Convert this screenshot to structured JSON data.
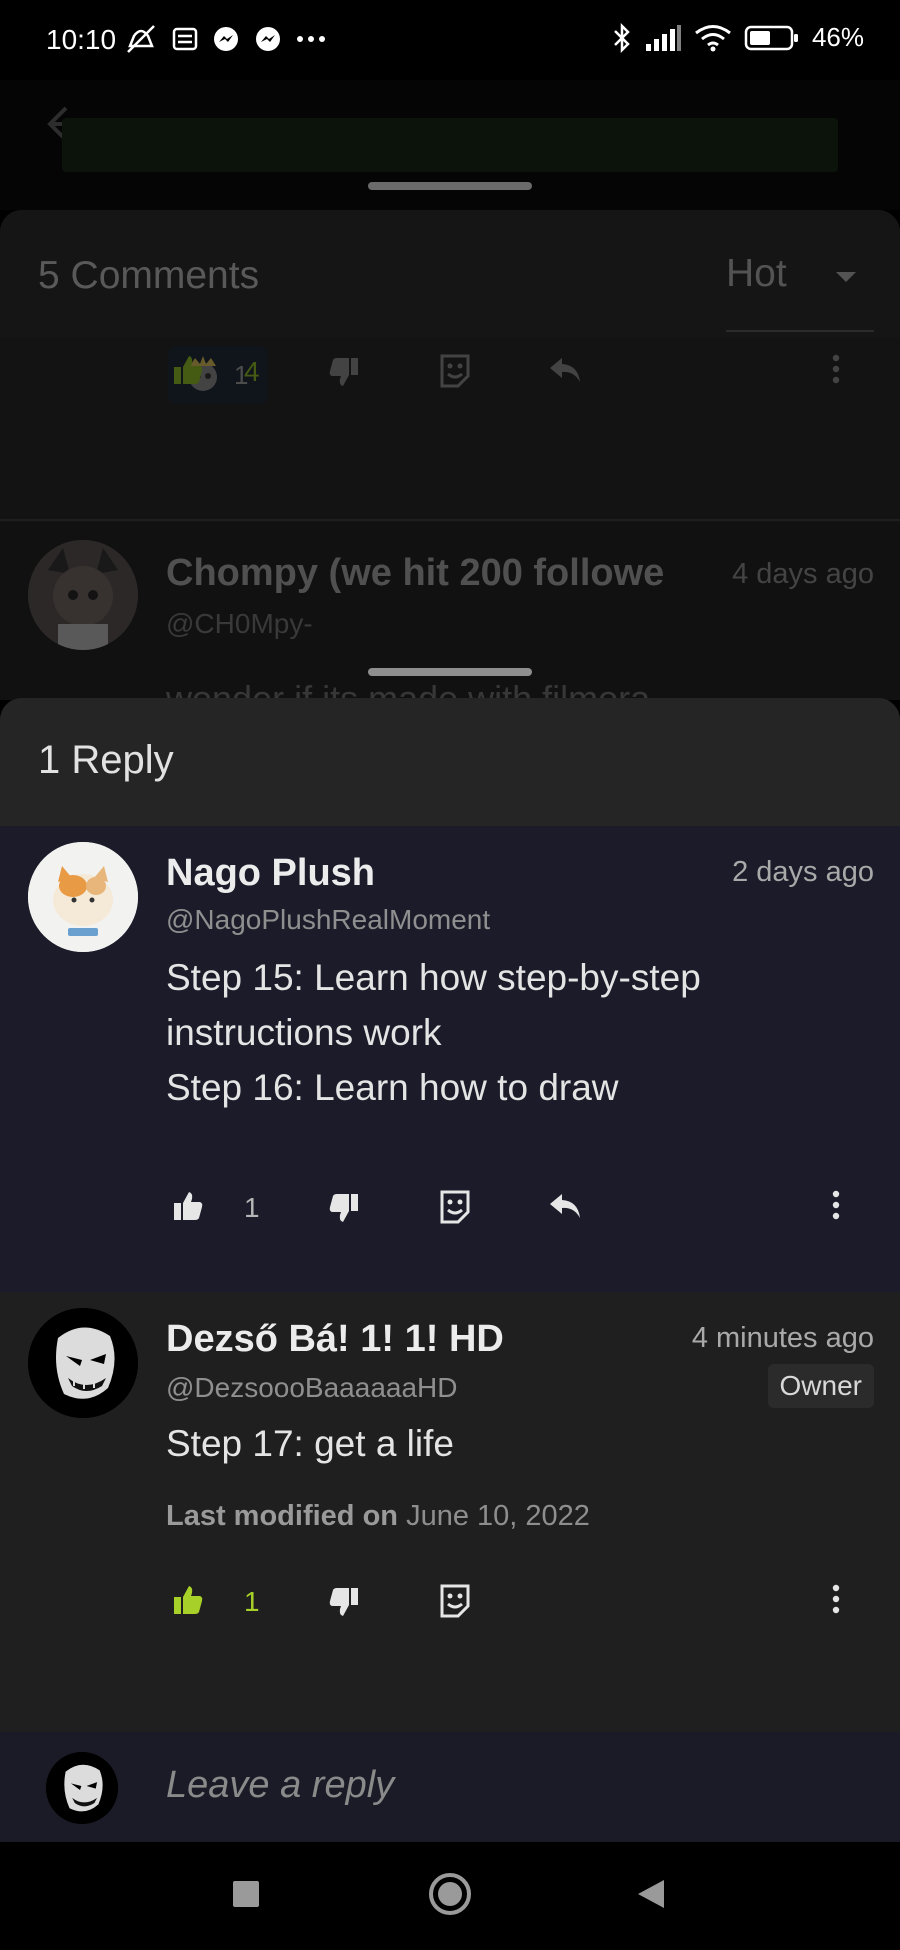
{
  "status_bar": {
    "time": "10:10",
    "battery": "46%",
    "icons": [
      "mute-icon",
      "news-icon",
      "messenger-icon",
      "messenger-icon",
      "more-dots-icon",
      "bluetooth-icon",
      "signal-icon",
      "wifi-icon",
      "battery-icon"
    ]
  },
  "comments_sheet": {
    "title": "5 Comments",
    "sort": "Hot",
    "prev_comment": {
      "reaction_count": "1",
      "like_count": "4"
    },
    "dim_comment": {
      "name": "Chompy (we hit 200 followe",
      "time": "4 days ago",
      "handle": "@CH0Mpy-",
      "body": "wonder if its made with filmora"
    }
  },
  "reply_sheet": {
    "title": "1 Reply",
    "comments": [
      {
        "name": "Nago Plush",
        "time": "2 days ago",
        "handle": "@NagoPlushRealMoment",
        "paragraphs": [
          "Step 15: Learn how step-by-step instructions work",
          "Step 16: Learn how to draw"
        ],
        "like_count": "1"
      },
      {
        "name": "Dezső Bá! 1! 1! HD",
        "time": "4 minutes ago",
        "handle": "@DezsoooBaaaaaaHD",
        "badge": "Owner",
        "paragraphs": [
          "Step 17: get a life"
        ],
        "modified_label": "Last modified on",
        "modified_date": "June 10, 2022",
        "like_count": "1"
      }
    ],
    "input_placeholder": "Leave a reply"
  },
  "colors": {
    "accent_green": "#a7d129",
    "sheet_bg": "#1f1f1f",
    "highlight_bg": "#1b1b2a"
  }
}
